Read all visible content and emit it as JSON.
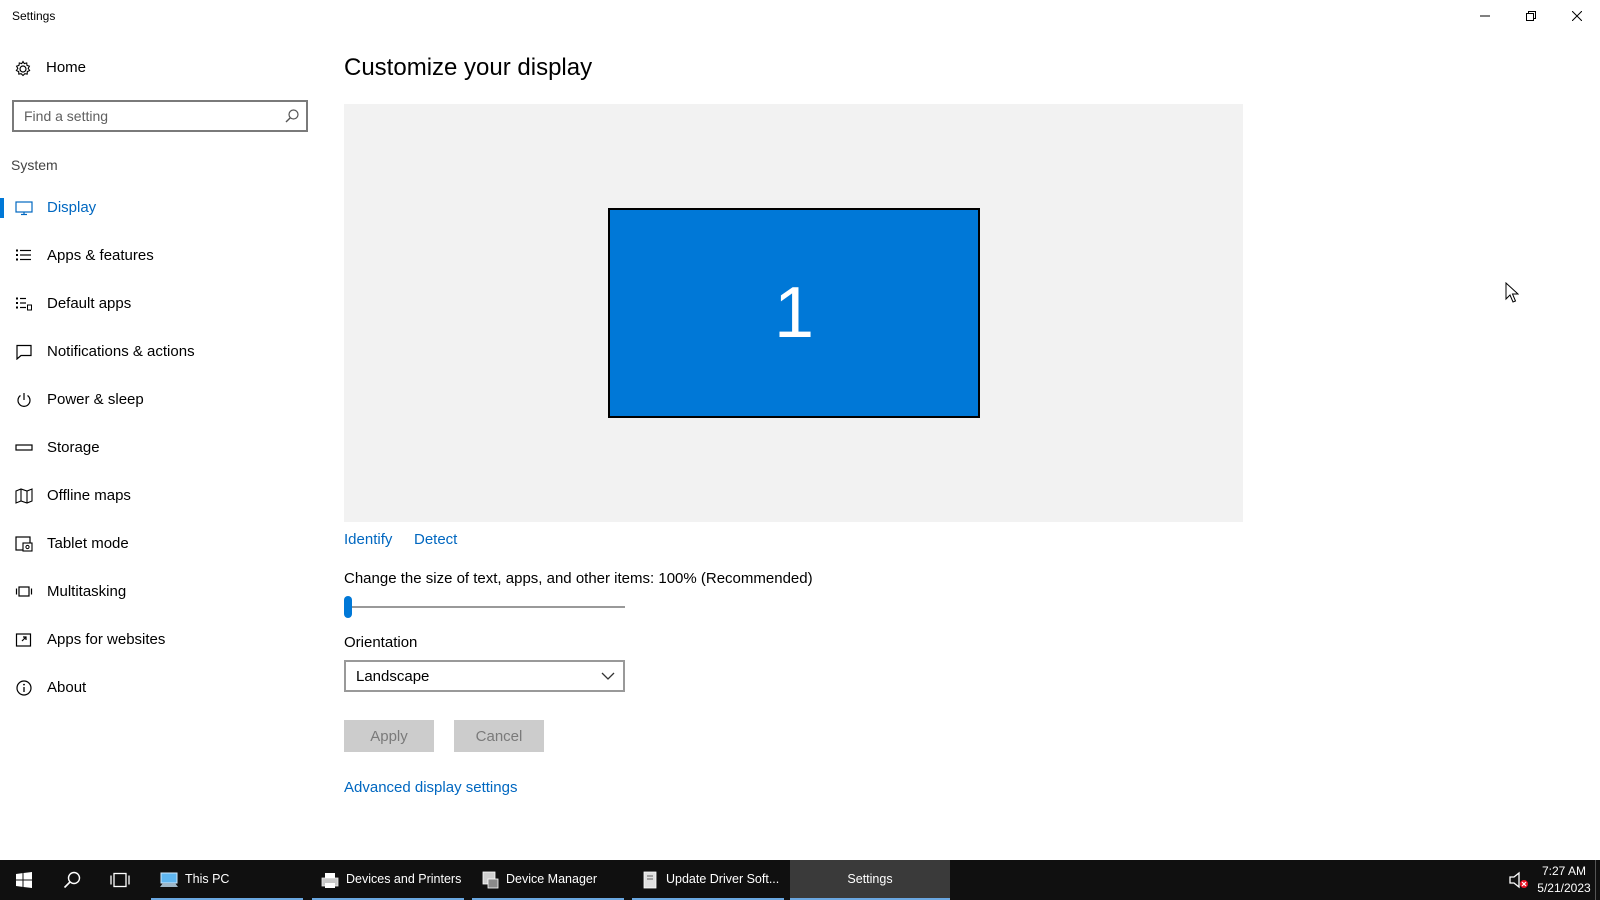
{
  "window": {
    "title": "Settings"
  },
  "sidebar": {
    "home_label": "Home",
    "search_placeholder": "Find a setting",
    "section_label": "System",
    "items": [
      {
        "label": "Display",
        "icon": "monitor-icon",
        "selected": true
      },
      {
        "label": "Apps & features",
        "icon": "list-icon"
      },
      {
        "label": "Default apps",
        "icon": "default-apps-icon"
      },
      {
        "label": "Notifications & actions",
        "icon": "notification-icon"
      },
      {
        "label": "Power & sleep",
        "icon": "power-icon"
      },
      {
        "label": "Storage",
        "icon": "storage-icon"
      },
      {
        "label": "Offline maps",
        "icon": "map-icon"
      },
      {
        "label": "Tablet mode",
        "icon": "tablet-icon"
      },
      {
        "label": "Multitasking",
        "icon": "multitasking-icon"
      },
      {
        "label": "Apps for websites",
        "icon": "apps-websites-icon"
      },
      {
        "label": "About",
        "icon": "info-icon"
      }
    ]
  },
  "main": {
    "title": "Customize your display",
    "monitor_number": "1",
    "identify_link": "Identify",
    "detect_link": "Detect",
    "scale_label": "Change the size of text, apps, and other items: 100% (Recommended)",
    "scale_slider_fraction": 0,
    "orientation_label": "Orientation",
    "orientation_value": "Landscape",
    "apply_label": "Apply",
    "cancel_label": "Cancel",
    "advanced_link": "Advanced display settings"
  },
  "taskbar": {
    "apps": [
      {
        "label": "This PC",
        "icon": "this-pc-icon",
        "running": true
      },
      {
        "label": "Devices and Printers",
        "icon": "printer-icon",
        "running": true
      },
      {
        "label": "Device Manager",
        "icon": "device-manager-icon",
        "running": true
      },
      {
        "label": "Update Driver Soft...",
        "icon": "update-driver-icon",
        "running": true
      },
      {
        "label": "Settings",
        "icon": "settings-icon",
        "running": true,
        "active": true
      }
    ],
    "clock_time": "7:27 AM",
    "clock_date": "5/21/2023"
  },
  "colors": {
    "accent": "#0078d7",
    "link": "#0067c0",
    "taskbar": "#101010",
    "preview_bg": "#f2f2f2",
    "disabled_button": "#cccccc"
  }
}
